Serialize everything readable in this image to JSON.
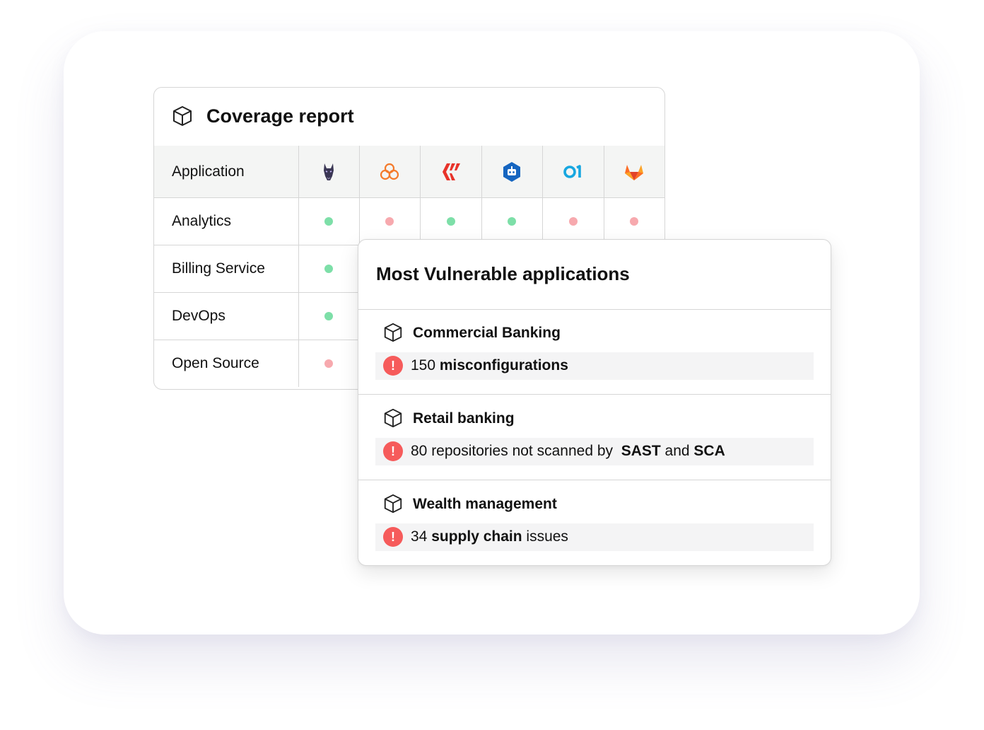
{
  "coverage_report": {
    "title": "Coverage report",
    "header_label": "Application",
    "tools": [
      {
        "icon": "doberman-icon",
        "color": "#3a3654"
      },
      {
        "icon": "cloud-icon",
        "color": "#f47a2a"
      },
      {
        "icon": "chevrons-icon",
        "color": "#e8332a"
      },
      {
        "icon": "bot-hexagon-icon",
        "color": "#1565c0"
      },
      {
        "icon": "o1-icon",
        "color": "#17a7e0"
      },
      {
        "icon": "gitlab-fox-icon",
        "color": "#e24329"
      }
    ],
    "rows": [
      {
        "label": "Analytics",
        "status": [
          "ok",
          "bad",
          "ok",
          "ok",
          "bad",
          "bad"
        ]
      },
      {
        "label": "Billing Service",
        "status": [
          "ok"
        ]
      },
      {
        "label": "DevOps",
        "status": [
          "ok"
        ]
      },
      {
        "label": "Open Source",
        "status": [
          "bad"
        ]
      }
    ],
    "colors": {
      "ok": "#7ddfa8",
      "bad": "#f7a9ae"
    }
  },
  "most_vulnerable": {
    "title": "Most Vulnerable applications",
    "items": [
      {
        "name": "Commercial Banking",
        "issue": {
          "prefix": "150 ",
          "bold1": "misconfigurations",
          "mid": "",
          "bold2": "",
          "suffix": ""
        }
      },
      {
        "name": "Retail banking",
        "issue": {
          "prefix": "80 repositories not scanned by  ",
          "bold1": "SAST",
          "mid": " and ",
          "bold2": "SCA",
          "suffix": ""
        }
      },
      {
        "name": "Wealth management",
        "issue": {
          "prefix": "34 ",
          "bold1": "supply chain",
          "mid": " issues",
          "bold2": "",
          "suffix": ""
        }
      }
    ],
    "alert_color": "#f65b5b"
  }
}
